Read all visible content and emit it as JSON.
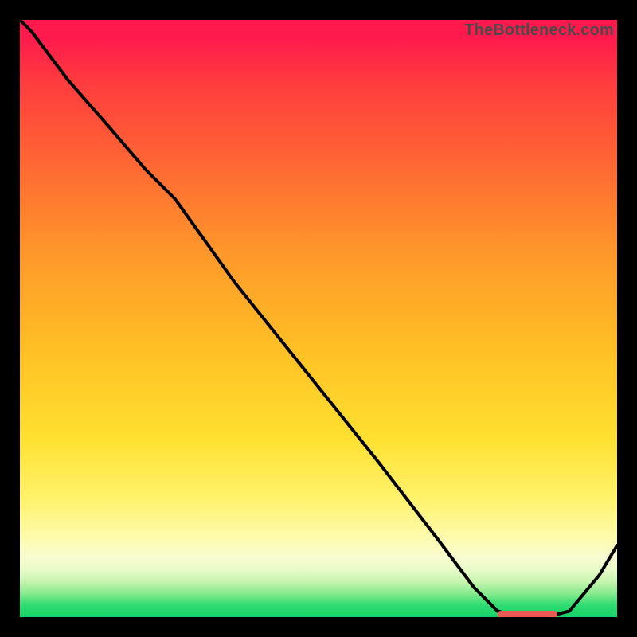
{
  "watermark": "TheBottleneck.com",
  "colors": {
    "curve": "#000000",
    "optimal_bar": "#ec5a54",
    "gradient_top": "#ff1a4d",
    "gradient_bottom": "#17d36a",
    "frame": "#000000"
  },
  "chart_data": {
    "type": "line",
    "title": "",
    "xlabel": "",
    "ylabel": "",
    "xlim": [
      0,
      100
    ],
    "ylim": [
      0,
      100
    ],
    "grid": false,
    "legend": false,
    "x": [
      0,
      2,
      8,
      15,
      21,
      26,
      36,
      48,
      60,
      70,
      76,
      80,
      84,
      88,
      92,
      97,
      100
    ],
    "values": [
      100,
      98,
      90,
      82,
      75,
      70,
      56,
      41,
      26,
      13,
      5,
      1,
      0,
      0,
      1,
      7,
      12
    ],
    "optimal_range_x": [
      80,
      90
    ],
    "optimal_y": 0.6,
    "notes": "Heat-gradient bottleneck curve; minimum (optimal zone) marked by red bar near x≈80–90."
  }
}
